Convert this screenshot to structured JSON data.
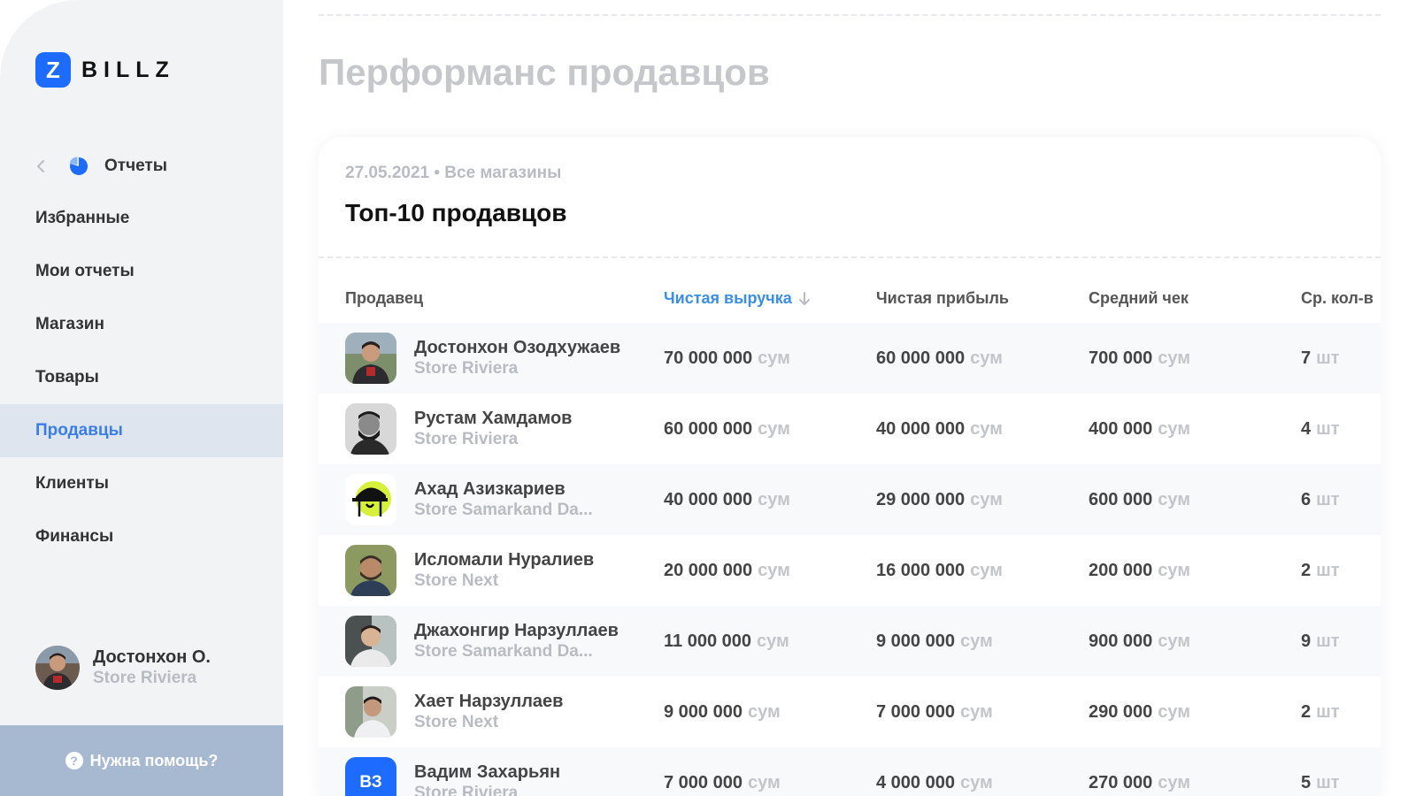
{
  "app": {
    "logo_letter": "Z",
    "logo_text": "BILLZ",
    "brand_color": "#1d6bff"
  },
  "sidebar": {
    "section_label": "Отчеты",
    "items": [
      {
        "label": "Избранные"
      },
      {
        "label": "Мои отчеты"
      },
      {
        "label": "Магазин"
      },
      {
        "label": "Товары"
      },
      {
        "label": "Продавцы",
        "active": true
      },
      {
        "label": "Клиенты"
      },
      {
        "label": "Финансы"
      }
    ],
    "user": {
      "name": "Достонхон О.",
      "store": "Store Riviera"
    },
    "help_label": "Нужна помощь?"
  },
  "page": {
    "title": "Перформанс продавцов"
  },
  "card": {
    "subtitle": "27.05.2021 • Все магазины",
    "title": "Топ-10 продавцов"
  },
  "table": {
    "headers": {
      "seller": "Продавец",
      "net_revenue": "Чистая выручка",
      "net_profit": "Чистая прибыль",
      "avg_check": "Средний чек",
      "avg_qty": "Ср. кол-в"
    },
    "rows": [
      {
        "name": "Достонхон Озодхужаев",
        "store": "Store Riviera",
        "revenue": "70 000 000",
        "revenue_unit": "сум",
        "profit": "60 000 000",
        "profit_unit": "сум",
        "check": "700 000",
        "check_unit": "сум",
        "qty": "7",
        "qty_unit": "шт"
      },
      {
        "name": "Рустам Хамдамов",
        "store": "Store Riviera",
        "revenue": "60 000 000",
        "revenue_unit": "сум",
        "profit": "40 000 000",
        "profit_unit": "сум",
        "check": "400 000",
        "check_unit": "сум",
        "qty": "4",
        "qty_unit": "шт"
      },
      {
        "name": "Ахад Азизкариев",
        "store": "Store Samarkand Da...",
        "revenue": "40 000 000",
        "revenue_unit": "сум",
        "profit": "29 000 000",
        "profit_unit": "сум",
        "check": "600 000",
        "check_unit": "сум",
        "qty": "6",
        "qty_unit": "шт"
      },
      {
        "name": "Исломали Нуралиев",
        "store": "Store Next",
        "revenue": "20 000 000",
        "revenue_unit": "сум",
        "profit": "16 000 000",
        "profit_unit": "сум",
        "check": "200 000",
        "check_unit": "сум",
        "qty": "2",
        "qty_unit": "шт"
      },
      {
        "name": "Джахонгир Нарзуллаев",
        "store": "Store Samarkand Da...",
        "revenue": "11 000 000",
        "revenue_unit": "сум",
        "profit": "9 000 000",
        "profit_unit": "сум",
        "check": "900 000",
        "check_unit": "сум",
        "qty": "9",
        "qty_unit": "шт"
      },
      {
        "name": "Хает Нарзуллаев",
        "store": "Store Next",
        "revenue": "9 000 000",
        "revenue_unit": "сум",
        "profit": "7 000 000",
        "profit_unit": "сум",
        "check": "290 000",
        "check_unit": "сум",
        "qty": "2",
        "qty_unit": "шт"
      },
      {
        "name": "Вадим Захарьян",
        "initials": "ВЗ",
        "store": "Store Riviera",
        "revenue": "7 000 000",
        "revenue_unit": "сум",
        "profit": "4 000 000",
        "profit_unit": "сум",
        "check": "270 000",
        "check_unit": "сум",
        "qty": "5",
        "qty_unit": "шт"
      }
    ]
  }
}
